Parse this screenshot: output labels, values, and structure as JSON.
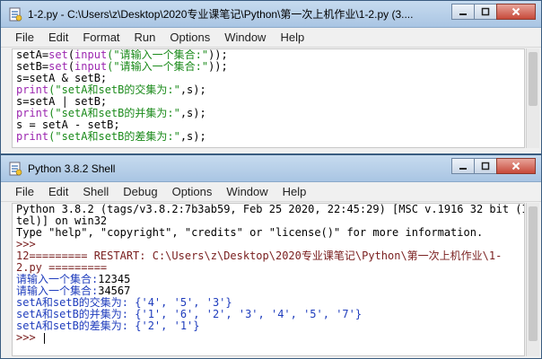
{
  "editor": {
    "title": "1-2.py - C:\\Users\\z\\Desktop\\2020专业课笔记\\Python\\第一次上机作业\\1-2.py (3....",
    "menu": [
      "File",
      "Edit",
      "Format",
      "Run",
      "Options",
      "Window",
      "Help"
    ],
    "lines": [
      [
        {
          "t": "setA=",
          "c": "n"
        },
        {
          "t": "set",
          "c": "k"
        },
        {
          "t": "(",
          "c": "n"
        },
        {
          "t": "input",
          "c": "k"
        },
        {
          "t": "(\"请输入一个集合:\"",
          "c": "s"
        },
        {
          "t": "));",
          "c": "n"
        }
      ],
      [
        {
          "t": "setB=",
          "c": "n"
        },
        {
          "t": "set",
          "c": "k"
        },
        {
          "t": "(",
          "c": "n"
        },
        {
          "t": "input",
          "c": "k"
        },
        {
          "t": "(\"请输入一个集合:\"",
          "c": "s"
        },
        {
          "t": "));",
          "c": "n"
        }
      ],
      [
        {
          "t": "s=setA & setB;",
          "c": "n"
        }
      ],
      [
        {
          "t": "print",
          "c": "k"
        },
        {
          "t": "(\"setA和setB的交集为:\"",
          "c": "s"
        },
        {
          "t": ",s);",
          "c": "n"
        }
      ],
      [
        {
          "t": "s=setA | setB;",
          "c": "n"
        }
      ],
      [
        {
          "t": "print",
          "c": "k"
        },
        {
          "t": "(\"setA和setB的并集为:\"",
          "c": "s"
        },
        {
          "t": ",s);",
          "c": "n"
        }
      ],
      [
        {
          "t": "s = setA - setB;",
          "c": "n"
        }
      ],
      [
        {
          "t": "print",
          "c": "k"
        },
        {
          "t": "(\"setA和setB的差集为:\"",
          "c": "s"
        },
        {
          "t": ",s);",
          "c": "n"
        }
      ]
    ]
  },
  "shell": {
    "title": "Python 3.8.2 Shell",
    "menu": [
      "File",
      "Edit",
      "Shell",
      "Debug",
      "Options",
      "Window",
      "Help"
    ],
    "lines": [
      [
        {
          "t": "Python 3.8.2 (tags/v3.8.2:7b3ab59, Feb 25 2020, 22:45:29) [MSC v.1916 32 bit (In",
          "c": "n"
        }
      ],
      [
        {
          "t": "tel)] on win32",
          "c": "n"
        }
      ],
      [
        {
          "t": "Type \"help\", \"copyright\", \"credits\" or \"license()\" for more information.",
          "c": "n"
        }
      ],
      [
        {
          "t": ">>> ",
          "c": "r"
        }
      ],
      [
        {
          "t": "12========= RESTART: C:\\Users\\z\\Desktop\\2020专业课笔记\\Python\\第一次上机作业\\1-",
          "c": "r"
        }
      ],
      [
        {
          "t": "2.py =========",
          "c": "r"
        }
      ],
      [
        {
          "t": "请输入一个集合:",
          "c": "o"
        },
        {
          "t": "12345",
          "c": "n"
        }
      ],
      [
        {
          "t": "请输入一个集合:",
          "c": "o"
        },
        {
          "t": "34567",
          "c": "n"
        }
      ],
      [
        {
          "t": "setA和setB的交集为: {'4', '5', '3'}",
          "c": "o"
        }
      ],
      [
        {
          "t": "setA和setB的并集为: {'1', '6', '2', '3', '4', '5', '7'}",
          "c": "o"
        }
      ],
      [
        {
          "t": "setA和setB的差集为: {'2', '1'}",
          "c": "o"
        }
      ],
      [
        {
          "t": ">>> ",
          "c": "r"
        }
      ]
    ]
  },
  "colors": {
    "keyword": "#9c27b0",
    "string": "#1a8a1a",
    "output": "#1f3dbd",
    "prompt": "#7a2020"
  },
  "icons": {
    "app": "python-idle-icon",
    "minimize": "minimize-icon",
    "maximize": "maximize-icon",
    "close": "close-icon"
  }
}
